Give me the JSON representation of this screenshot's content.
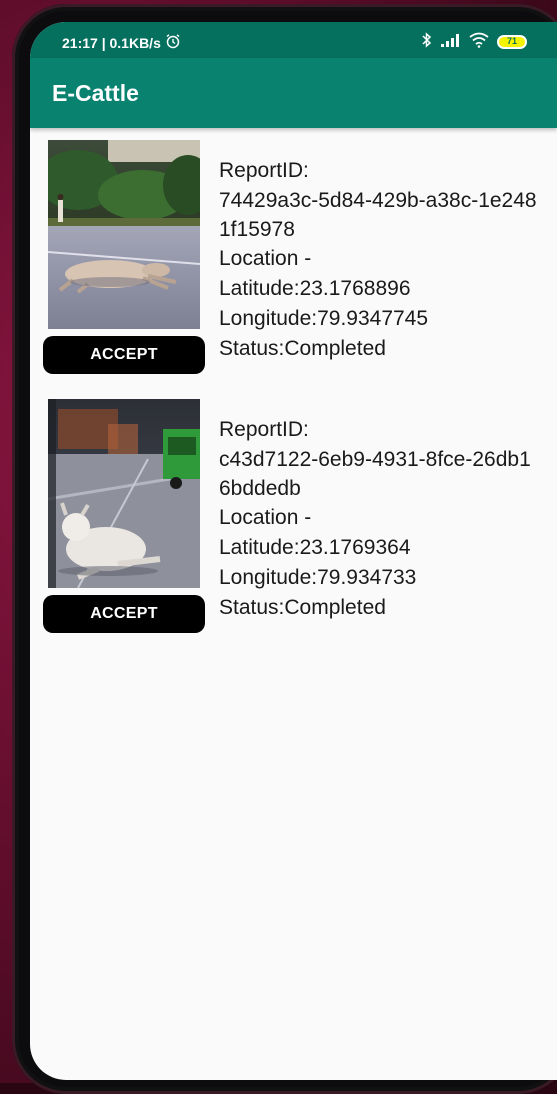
{
  "status_bar": {
    "time_speed": "21:17 | 0.1KB/s",
    "battery_level": "71"
  },
  "app_bar": {
    "title": "E-Cattle"
  },
  "reports": [
    {
      "id_label": "ReportID:",
      "id_value": "74429a3c-5d84-429b-a38c-1e2481f15978",
      "location_label": "Location -",
      "latitude": "Latitude:23.1768896",
      "longitude": "Longitude:79.9347745",
      "status": "Status:Completed",
      "accept_label": "ACCEPT"
    },
    {
      "id_label": "ReportID:",
      "id_value": "c43d7122-6eb9-4931-8fce-26db16bddedb",
      "location_label": "Location -",
      "latitude": "Latitude:23.1769364",
      "longitude": "Longitude:79.934733",
      "status": "Status:Completed",
      "accept_label": "ACCEPT"
    }
  ],
  "colors": {
    "status_bar": "#06705f",
    "app_bar": "#0a8270",
    "button": "#000000",
    "background": "#fafafa"
  },
  "icons": {
    "alarm": "alarm-clock-icon",
    "bluetooth": "bluetooth-icon",
    "signal": "signal-icon",
    "wifi": "wifi-icon",
    "battery": "battery-icon"
  }
}
